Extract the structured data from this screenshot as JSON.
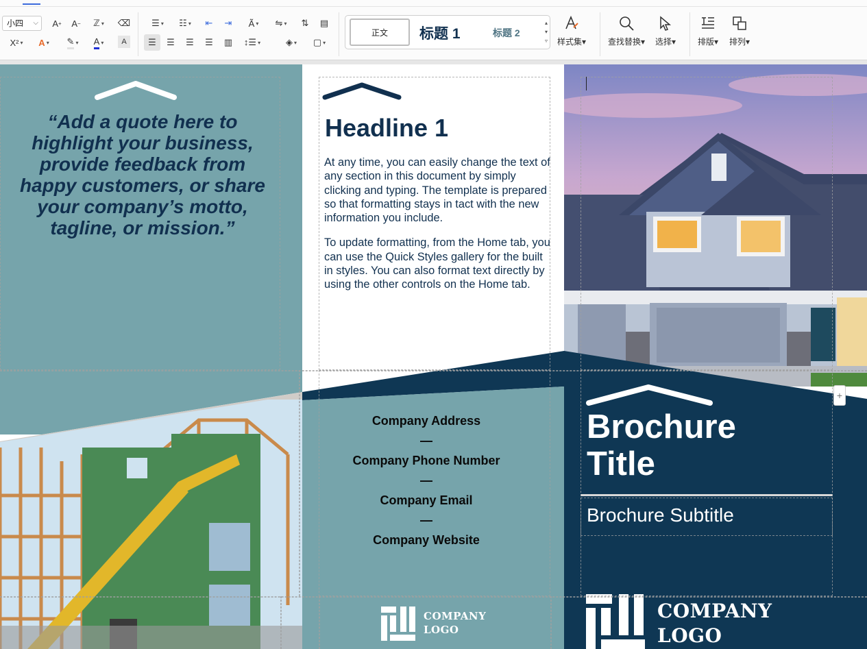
{
  "ribbon": {
    "font_size": "小四",
    "styles": {
      "normal": "正文",
      "heading1": "标题 1",
      "heading2": "标题 2"
    },
    "style_set_label": "样式集",
    "find_replace_label": "查找替换",
    "select_label": "选择",
    "layout_label": "排版",
    "arrange_label": "排列"
  },
  "document": {
    "quote": "“Add a quote here to highlight your business, provide feedback from happy customers, or share your company’s motto, tagline, or mission.”",
    "headline": "Headline 1",
    "paragraph1": "At any time, you can easily change the text of any section in this document by simply clicking and typing.  The template is prepared so that formatting stays in tact with the new information you include.",
    "paragraph2": "To update formatting, from the Home tab, you can use the Quick Styles gallery for the built in styles.  You can also format text directly by using the other controls on the Home tab.",
    "contact": {
      "address": "Company Address",
      "dash1": "—",
      "phone": "Company Phone Number",
      "dash2": "—",
      "email": "Company Email",
      "dash3": "—",
      "website": "Company Website"
    },
    "title_line1": "Brochure",
    "title_line2": "Title",
    "subtitle": "Brochure Subtitle",
    "logo_small": {
      "line1": "COMPANY",
      "line2": "LOGO"
    },
    "logo_big": {
      "line1": "COMPANY",
      "line2": "LOGO"
    }
  },
  "colors": {
    "navy": "#11304f",
    "teal": "#76a4ab",
    "dark_navy": "#0f3754"
  },
  "side_button": "+"
}
